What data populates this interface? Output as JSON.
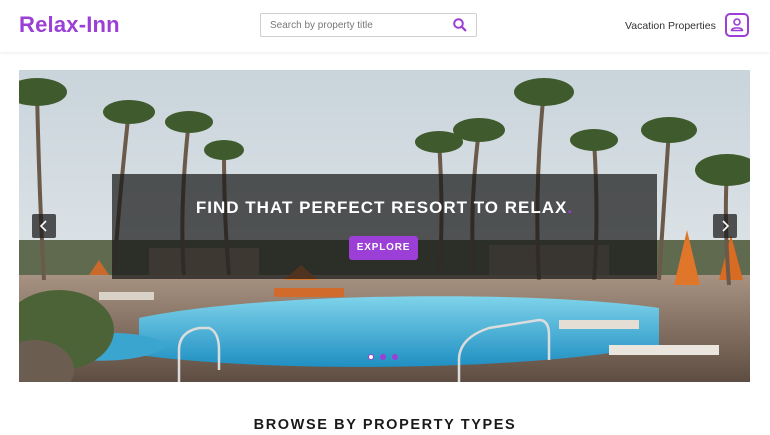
{
  "header": {
    "logo": "Relax-Inn",
    "search": {
      "placeholder": "Search by property title",
      "value": ""
    },
    "search_icon": "search-icon",
    "nav_link": "Vacation Properties",
    "user_icon": "user-icon"
  },
  "hero": {
    "headline": "FIND THAT PERFECT RESORT TO RELAX",
    "headline_dot": ".",
    "cta_label": "EXPLORE",
    "prev_icon": "chevron-left-icon",
    "next_icon": "chevron-right-icon",
    "slides": [
      {
        "active": true
      },
      {
        "active": false
      },
      {
        "active": false
      }
    ]
  },
  "section": {
    "title": "BROWSE BY PROPERTY TYPES"
  },
  "colors": {
    "brand": "#9b3fd6",
    "overlay": "#191919",
    "sky": "#dbe4ea",
    "pool": "#56bfe2"
  }
}
